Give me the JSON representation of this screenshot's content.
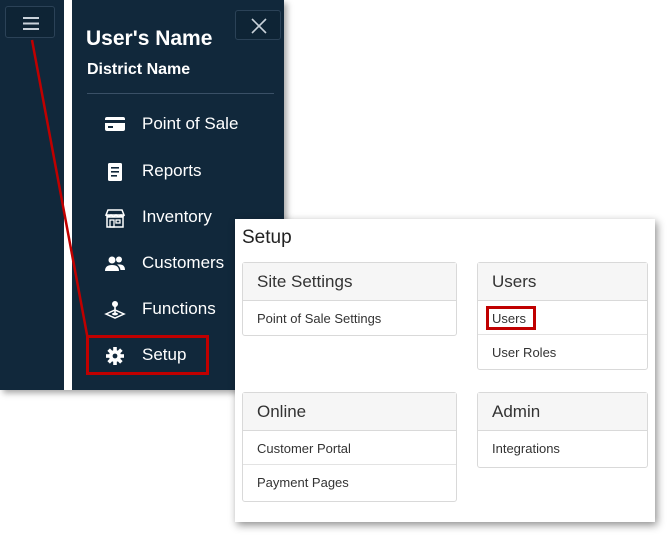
{
  "nav": {
    "user_name": "User's Name",
    "district_name": "District Name",
    "items": [
      {
        "label": "Point of Sale",
        "icon": "credit-card-icon"
      },
      {
        "label": "Reports",
        "icon": "document-icon"
      },
      {
        "label": "Inventory",
        "icon": "store-icon"
      },
      {
        "label": "Customers",
        "icon": "people-icon"
      },
      {
        "label": "Functions",
        "icon": "joystick-icon"
      },
      {
        "label": "Setup",
        "icon": "gear-icon"
      }
    ],
    "hamburger_icon": "hamburger-icon",
    "close_icon": "close-icon"
  },
  "setup": {
    "title": "Setup",
    "cards": {
      "site_settings": {
        "title": "Site Settings",
        "items": [
          "Point of Sale Settings"
        ]
      },
      "users": {
        "title": "Users",
        "items": [
          "Users",
          "User Roles"
        ]
      },
      "online": {
        "title": "Online",
        "items": [
          "Customer Portal",
          "Payment Pages"
        ]
      },
      "admin": {
        "title": "Admin",
        "items": [
          "Integrations"
        ]
      }
    }
  },
  "colors": {
    "nav_background": "#11283b",
    "highlight": "#c00000"
  }
}
